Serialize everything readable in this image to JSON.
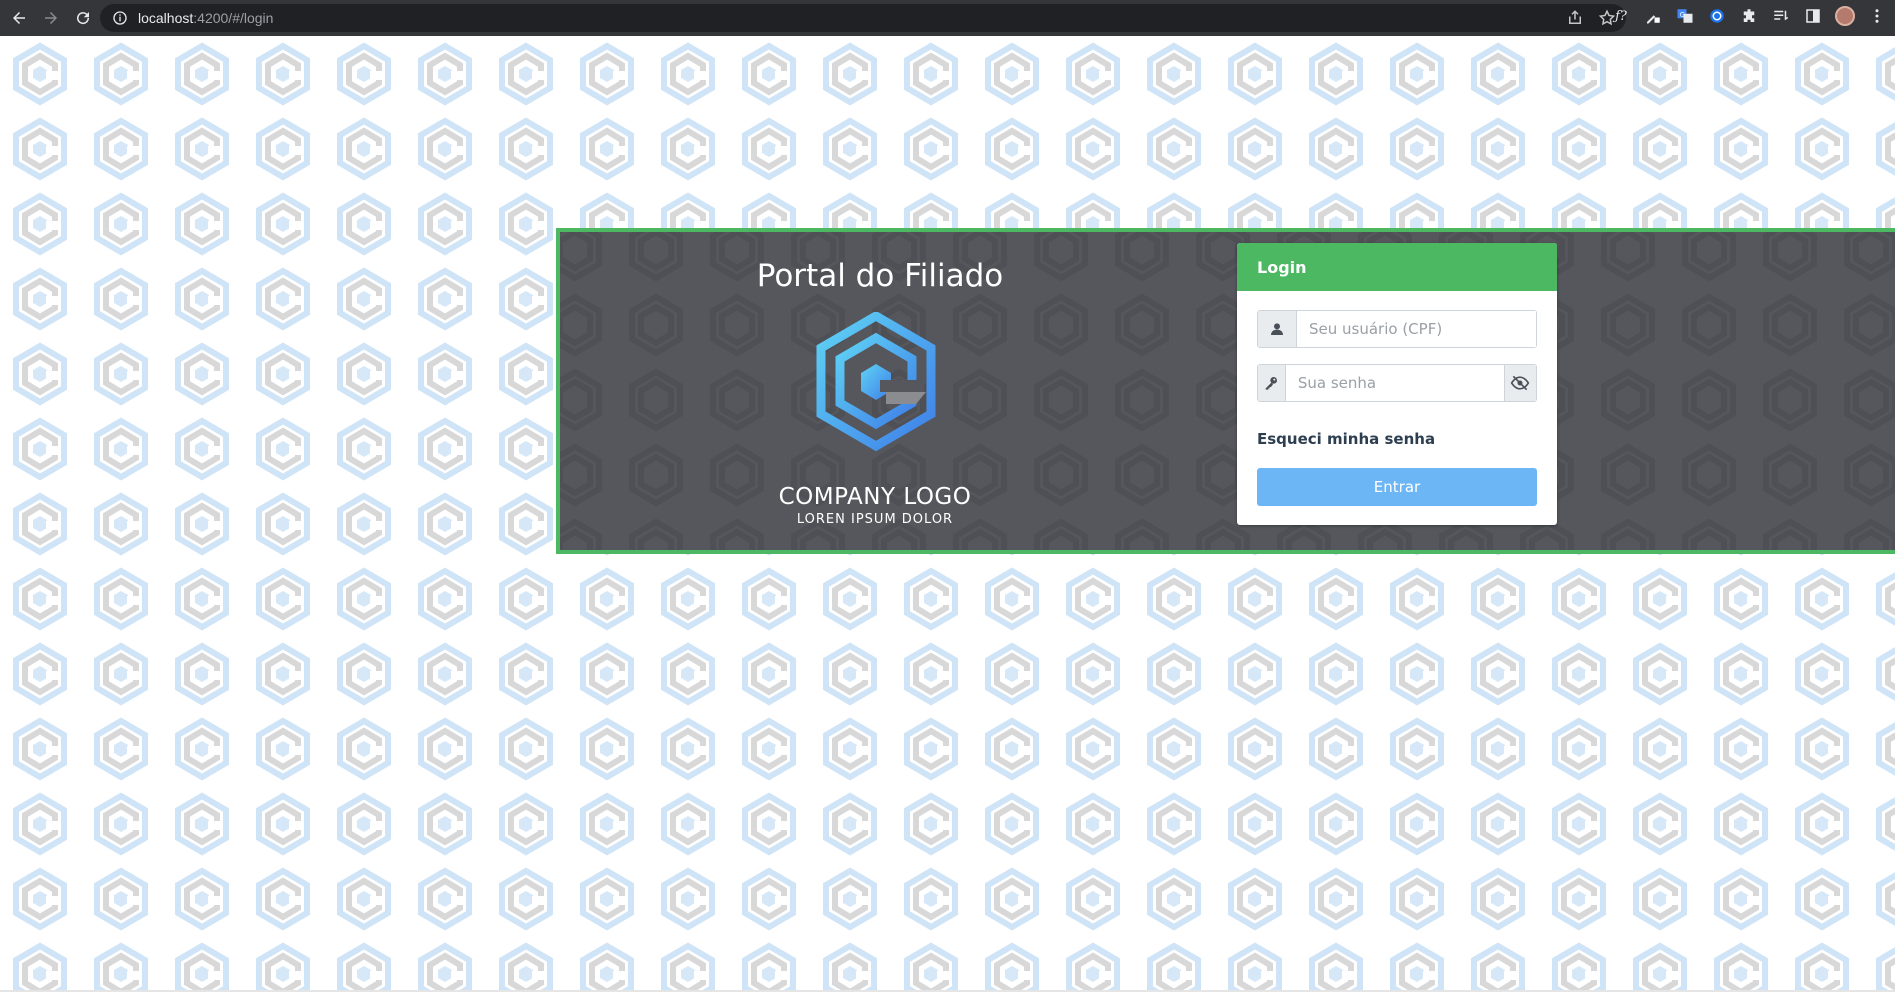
{
  "browser": {
    "url_host": "localhost",
    "url_rest": ":4200/#/login"
  },
  "page": {
    "title": "Portal do Filiado",
    "logo": {
      "name": "COMPANY LOGO",
      "tagline": "LOREN IPSUM DOLOR"
    },
    "accent_color": "#4cb862",
    "banner_color": "#55575c"
  },
  "login": {
    "header": "Login",
    "username_placeholder": "Seu usuário (CPF)",
    "password_placeholder": "Sua senha",
    "forgot_label": "Esqueci minha senha",
    "submit_label": "Entrar",
    "submit_color": "#6cb6f5"
  },
  "icons": {
    "user": "user-icon",
    "key": "key-icon",
    "eye_slash": "eye-slash-icon"
  }
}
